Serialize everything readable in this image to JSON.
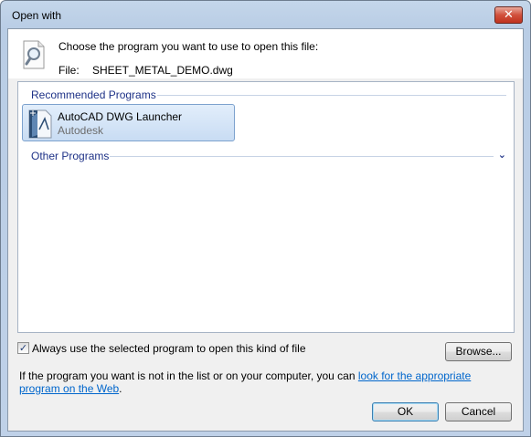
{
  "window": {
    "title": "Open with",
    "close_glyph": "✕"
  },
  "header": {
    "prompt": "Choose the program you want to use to open this file:",
    "file_label": "File:",
    "file_name": "SHEET_METAL_DEMO.dwg",
    "icon": "document-magnifier-icon"
  },
  "program_list": {
    "recommended_label": "Recommended Programs",
    "other_label": "Other Programs",
    "items": [
      {
        "name": "AutoCAD DWG Launcher",
        "publisher": "Autodesk",
        "icon": "autocad-dwg-icon",
        "selected": true
      }
    ]
  },
  "options": {
    "always_use_label": "Always use the selected program to open this kind of file",
    "always_use_checked": true,
    "check_glyph": "✓"
  },
  "buttons": {
    "browse": "Browse...",
    "ok": "OK",
    "cancel": "Cancel"
  },
  "info": {
    "text": "If the program you want is not in the list or on your computer, you can ",
    "link_text": "look for the appropriate program on the Web",
    "suffix": "."
  },
  "colors": {
    "accent_blue": "#1e3287",
    "link": "#0066cc",
    "close_red": "#c0331f"
  }
}
